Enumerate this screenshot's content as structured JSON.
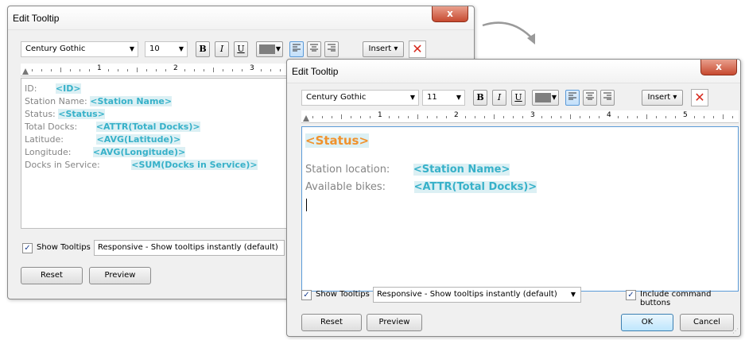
{
  "dialog1": {
    "title": "Edit Tooltip",
    "close_label": "x",
    "font_family_value": "Century Gothic",
    "font_size_value": "10",
    "bold_label": "B",
    "italic_label": "I",
    "underline_label": "U",
    "insert_label": "Insert ▾",
    "ruler_numbers": [
      "1",
      "2",
      "3"
    ],
    "content": [
      {
        "label": "ID:",
        "field": "<ID>"
      },
      {
        "label": "Station Name:",
        "field": "<Station Name>"
      },
      {
        "label": "Status:",
        "field": "<Status>"
      },
      {
        "label": "Total Docks:",
        "field": "<ATTR(Total Docks)>"
      },
      {
        "label": "Latitude:",
        "field": "<AVG(Latitude)>"
      },
      {
        "label": "Longitude:",
        "field": "<AVG(Longitude)>"
      },
      {
        "label": "Docks in Service:",
        "field": "<SUM(Docks in Service)>"
      }
    ],
    "show_tooltips_label": "Show Tooltips",
    "show_tooltips_checked": true,
    "tooltip_mode_value": "Responsive - Show tooltips instantly (default)",
    "reset_label": "Reset",
    "preview_label": "Preview"
  },
  "dialog2": {
    "title": "Edit Tooltip",
    "close_label": "x",
    "font_family_value": "Century Gothic",
    "font_size_value": "11",
    "bold_label": "B",
    "italic_label": "I",
    "underline_label": "U",
    "insert_label": "Insert ▾",
    "ruler_numbers": [
      "1",
      "2",
      "3",
      "4",
      "5"
    ],
    "status_header": "<Status>",
    "content": [
      {
        "label": "Station location:",
        "field": "<Station Name>"
      },
      {
        "label": "Available bikes:",
        "field": "<ATTR(Total Docks)>"
      }
    ],
    "show_tooltips_label": "Show Tooltips",
    "show_tooltips_checked": true,
    "tooltip_mode_value": "Responsive - Show tooltips instantly (default)",
    "include_command_buttons_label": "Include command buttons",
    "include_command_buttons_checked": true,
    "reset_label": "Reset",
    "preview_label": "Preview",
    "ok_label": "OK",
    "cancel_label": "Cancel"
  },
  "icons": {
    "clear_formatting": "x-mark-icon",
    "transition_arrow": "curved-arrow-icon",
    "checkmark": "check-icon"
  },
  "colors": {
    "field_text": "#37b1c9",
    "status_header": "#f0922d",
    "label_text": "#858585",
    "close_button": "#c74a30"
  }
}
